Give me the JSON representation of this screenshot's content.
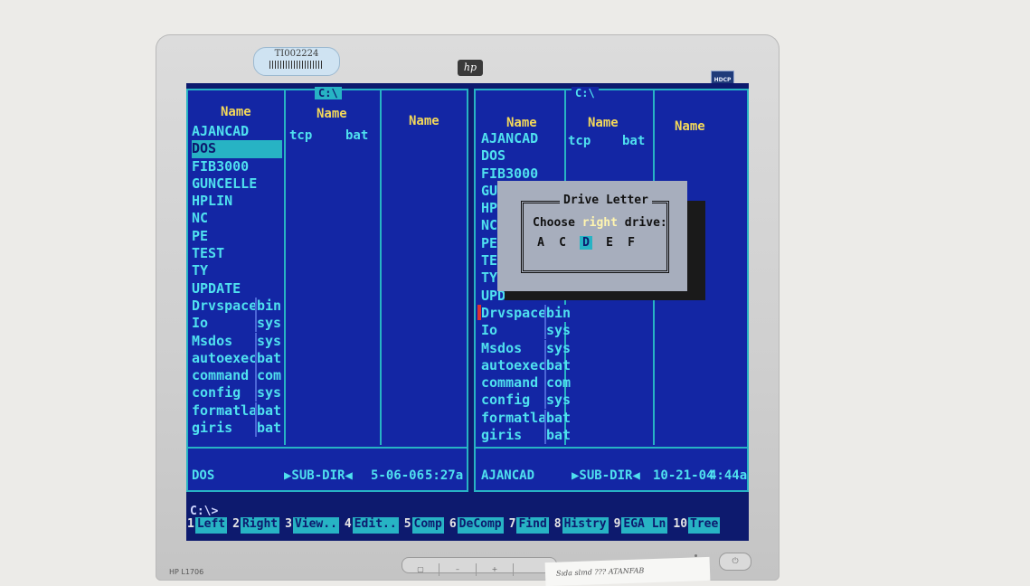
{
  "hardware": {
    "asset_tag": "TI002224",
    "brand_logo": "hp",
    "badge": "HDCP",
    "model": "HP L1706",
    "sticky_note": "Sıda slmd ??? ATANFAB"
  },
  "screen": {
    "left_panel": {
      "path": "C:\\",
      "headers": [
        "Name",
        "Name",
        "Name"
      ],
      "files": [
        {
          "name": "AJANCAD",
          "ext": ""
        },
        {
          "name": "DOS",
          "ext": ""
        },
        {
          "name": "FIB3000",
          "ext": ""
        },
        {
          "name": "GUNCELLE",
          "ext": ""
        },
        {
          "name": "HPLIN",
          "ext": ""
        },
        {
          "name": "NC",
          "ext": ""
        },
        {
          "name": "PE",
          "ext": ""
        },
        {
          "name": "TEST",
          "ext": ""
        },
        {
          "name": "TY",
          "ext": ""
        },
        {
          "name": "UPDATE",
          "ext": ""
        },
        {
          "name": "Drvspace",
          "ext": "bin"
        },
        {
          "name": "Io",
          "ext": "sys"
        },
        {
          "name": "Msdos",
          "ext": "sys"
        },
        {
          "name": "autoexec",
          "ext": "bat"
        },
        {
          "name": "command",
          "ext": "com"
        },
        {
          "name": "config",
          "ext": "sys"
        },
        {
          "name": "formatla",
          "ext": "bat"
        },
        {
          "name": "giris",
          "ext": "bat"
        }
      ],
      "col2_file": {
        "name": "tcp",
        "ext": "bat"
      },
      "selected_index": 1,
      "status_name": "DOS",
      "status_type": "▶SUB-DIR◀",
      "status_date": "5-06-06",
      "status_time": "5:27a"
    },
    "right_panel": {
      "path": "C:\\",
      "headers": [
        "Name",
        "Name",
        "Name"
      ],
      "files": [
        {
          "name": "AJANCAD",
          "ext": ""
        },
        {
          "name": "DOS",
          "ext": ""
        },
        {
          "name": "FIB3000",
          "ext": ""
        },
        {
          "name": "GUN",
          "ext": ""
        },
        {
          "name": "HPL",
          "ext": ""
        },
        {
          "name": "NC",
          "ext": ""
        },
        {
          "name": "PE",
          "ext": ""
        },
        {
          "name": "TES",
          "ext": ""
        },
        {
          "name": "TY",
          "ext": ""
        },
        {
          "name": "UPDATE",
          "ext": ""
        },
        {
          "name": "Drvspace",
          "ext": "bin"
        },
        {
          "name": "Io",
          "ext": "sys"
        },
        {
          "name": "Msdos",
          "ext": "sys"
        },
        {
          "name": "autoexec",
          "ext": "bat"
        },
        {
          "name": "command",
          "ext": "com"
        },
        {
          "name": "config",
          "ext": "sys"
        },
        {
          "name": "formatla",
          "ext": "bat"
        },
        {
          "name": "giris",
          "ext": "bat"
        }
      ],
      "col2_file": {
        "name": "tcp",
        "ext": "bat"
      },
      "status_name": "AJANCAD",
      "status_type": "▶SUB-DIR◀",
      "status_date": "10-21-04",
      "status_time": "4:44a"
    },
    "dialog": {
      "title": "Drive Letter",
      "prompt_before": "Choose ",
      "prompt_highlight": "right",
      "prompt_after": " drive:",
      "drives": [
        "A",
        "C",
        "D",
        "E",
        "F"
      ],
      "selected_drive": "D"
    },
    "command_prompt": "C:\\>",
    "function_keys": [
      {
        "num": "1",
        "label": "Left"
      },
      {
        "num": "2",
        "label": "Right"
      },
      {
        "num": "3",
        "label": "View.."
      },
      {
        "num": "4",
        "label": "Edit.."
      },
      {
        "num": "5",
        "label": "Comp"
      },
      {
        "num": "6",
        "label": "DeComp"
      },
      {
        "num": "7",
        "label": "Find"
      },
      {
        "num": "8",
        "label": "Histry"
      },
      {
        "num": "9",
        "label": "EGA Ln"
      },
      {
        "num": "10",
        "label": "Tree"
      }
    ]
  },
  "colors": {
    "screen_bg": "#1326a4",
    "frame_cyan": "#27b3c4",
    "text_cyan": "#4fe0ef",
    "header_yellow": "#f2d75a",
    "dialog_gray": "#a7aebd"
  }
}
